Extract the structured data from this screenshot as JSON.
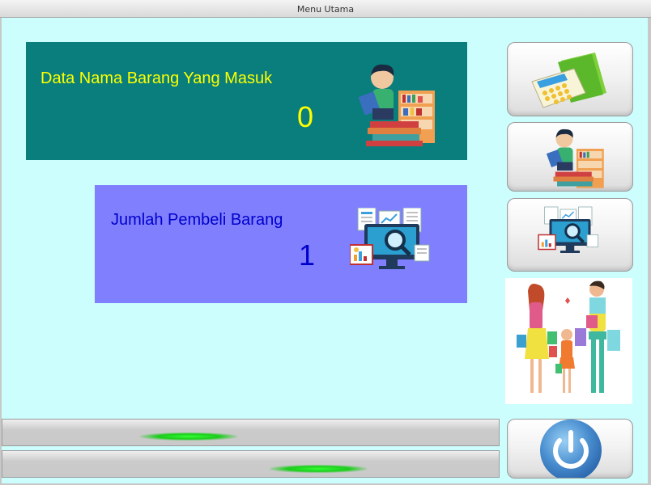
{
  "window": {
    "title": "Menu Utama"
  },
  "panels": {
    "incoming_goods": {
      "title": "Data Nama Barang Yang Masuk",
      "value": "0"
    },
    "buyers": {
      "title": "Jumlah Pembeli Barang",
      "value": "1"
    }
  },
  "sidebar": {
    "buttons": [
      {
        "icon": "calculator-folder-icon"
      },
      {
        "icon": "reading-books-icon"
      },
      {
        "icon": "monitor-analytics-icon"
      },
      {
        "icon": "power-icon"
      }
    ],
    "illustration": "shopping-family-illustration"
  },
  "status_bars": [
    {
      "icon": "green-glow-indicator"
    },
    {
      "icon": "green-glow-indicator"
    }
  ],
  "colors": {
    "background": "#ccfefe",
    "panel1": "#097e7c",
    "panel2": "#8080ff",
    "panel1_text": "#ffff00",
    "panel2_text": "#0000cc"
  }
}
